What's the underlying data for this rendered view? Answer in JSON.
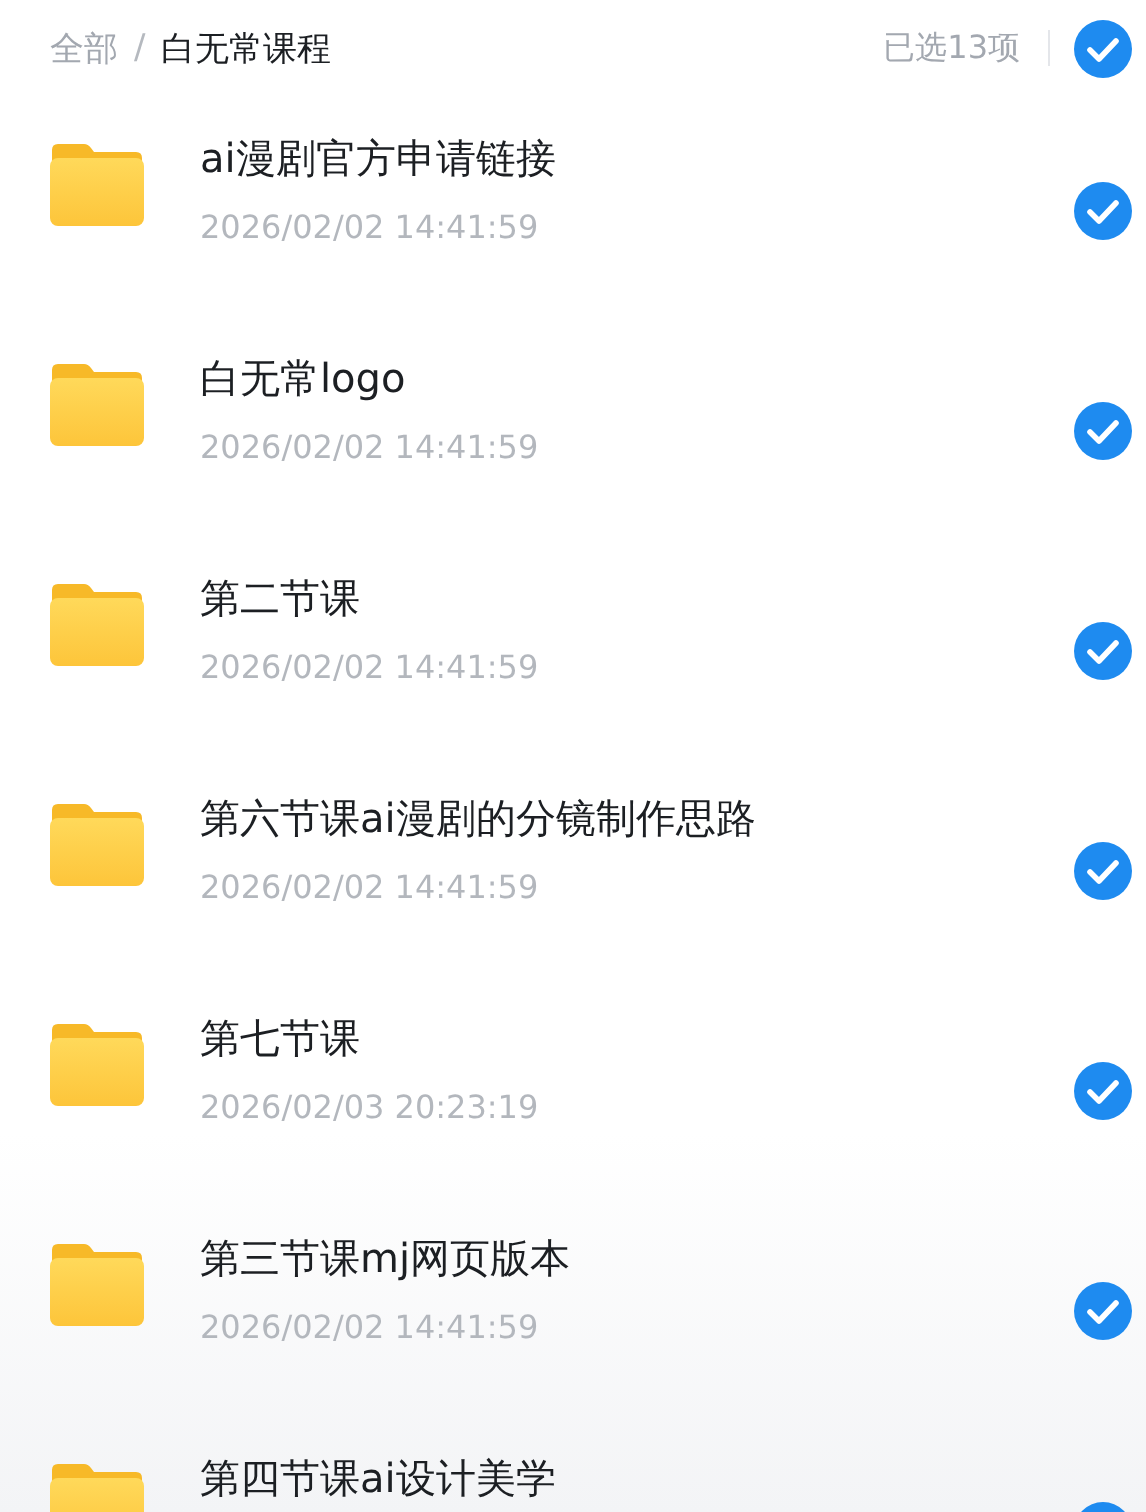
{
  "breadcrumb": [
    {
      "label": "全部",
      "current": false
    },
    {
      "label": "白无常课程",
      "current": true
    }
  ],
  "breadcrumb_separator": "/",
  "selection": {
    "count_label": "已选13项",
    "all_checked": true
  },
  "items": [
    {
      "name": "ai漫剧官方申请链接",
      "date": "2026/02/02 14:41:59",
      "checked": true
    },
    {
      "name": "白无常logo",
      "date": "2026/02/02 14:41:59",
      "checked": true
    },
    {
      "name": "第二节课",
      "date": "2026/02/02 14:41:59",
      "checked": true
    },
    {
      "name": "第六节课ai漫剧的分镜制作思路",
      "date": "2026/02/02 14:41:59",
      "checked": true
    },
    {
      "name": "第七节课",
      "date": "2026/02/03 20:23:19",
      "checked": true
    },
    {
      "name": "第三节课mj网页版本",
      "date": "2026/02/02 14:41:59",
      "checked": true
    },
    {
      "name": "第四节课ai设计美学",
      "checked": true
    }
  ]
}
